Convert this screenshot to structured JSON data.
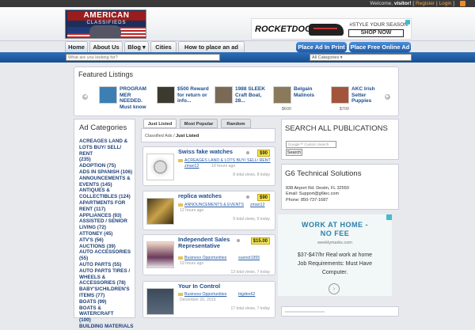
{
  "topbar": {
    "welcome_prefix": "Welcome, ",
    "user": "visitor!",
    "bracket_open": " [ ",
    "register": "Register",
    "sep": " | ",
    "login": "Login",
    "bracket_close": " ]"
  },
  "logo": {
    "line1": "AMERICAN",
    "line2": "CLASSIFIEDS"
  },
  "ad_banner": {
    "brand": "ROCKETDOG",
    "reg": "®",
    "tagline": "#STYLE YOUR SEASON",
    "box_text": "SHOP NOW"
  },
  "nav": {
    "items": [
      "Home",
      "About Us",
      "Blog ▾",
      "Cities",
      "How to place an ad"
    ]
  },
  "actions": {
    "print": "Place Ad In Print",
    "free": "Place Free Online Ad"
  },
  "search": {
    "placeholder": "What are you looking for?",
    "category": "All Categories"
  },
  "featured": {
    "title": "Featured Listings",
    "items": [
      {
        "title": "PROGRAM MER NEEDED. Must know",
        "price": ""
      },
      {
        "title": "$500 Reward for return or info...",
        "price": ""
      },
      {
        "title": "1988 SLEEK Craft Boat, 28...",
        "price": ""
      },
      {
        "title": "Belgain Malinois",
        "price": "$600"
      },
      {
        "title": "AKC Irish Setter Puppies",
        "price": "$700"
      }
    ]
  },
  "categories": {
    "title": "Ad Categories",
    "items": [
      "ACREAGES LAND &",
      "LOTS BUY/ SELL/ RENT",
      "(235)",
      "ADOPTION (75)",
      "ADS IN SPANISH (106)",
      "ANNOUNCEMENTS &",
      "EVENTS (145)",
      "ANTIQUES &",
      "COLLECTIBLES (124)",
      "APARTMENTS FOR",
      "RENT (117)",
      "APPLIANCES (93)",
      "ASSISTED / SENIOR",
      "LIVING (72)",
      "ATTONEY (45)",
      "ATV'S (56)",
      "AUCTIONS (39)",
      "AUTO ACCESSORIES",
      "(55)",
      "AUTO PARTS (55)",
      "AUTO PARTS TIRES /",
      "WHEELS &",
      "ACCESSORIES (78)",
      "BABY'S/CHILDREN'S",
      "ITEMS (77)",
      "BOATS (99)",
      "BOATS & WATERCRAFT",
      "(100)",
      "BUILDING MATERIALS"
    ]
  },
  "tabs": {
    "just_listed": "Just Listed",
    "most_popular": "Most Popular",
    "random": "Random"
  },
  "breadcrumb": {
    "root": "Classified Ads",
    "sep": " / ",
    "current": "Just Listed"
  },
  "listings": [
    {
      "title": "Swiss fake watches",
      "price": "$90",
      "category": "ACREAGES LAND & LOTS BUY/ SELL/ RENT",
      "user": "zman12",
      "time": "10 hours ago",
      "stats": "8 total views, 8 today"
    },
    {
      "title": "replica watches",
      "price": "$90",
      "category": "ANNOUNCEMENTS & EVENTS",
      "user": "zman12",
      "time": "12 hours ago",
      "stats": "9 total views, 9 today"
    },
    {
      "title": "Independent Sales Representative",
      "price": "$15.00",
      "category": "Business Opportunities",
      "user": "suenot1955",
      "time": "19 hours ago",
      "stats": "13 total views, 7 today"
    },
    {
      "title": "Your In Control",
      "price": "",
      "category": "Business Opportunities",
      "user": "bigdee62",
      "time": "December 20, 2015",
      "stats": "17 total views, 7 today"
    }
  ],
  "search_publications": {
    "title": "SEARCH ALL PUBLICATIONS",
    "placeholder": "Google™ Custom Search",
    "button": "Search"
  },
  "company": {
    "title": "G6 Technical Solutions",
    "address": "838 Airport Rd. Destin, FL 32550",
    "email": "Email: Support@g6tec.com",
    "phone": "Phone: 850-737-1687"
  },
  "google_ad": {
    "headline1": "WORK AT HOME -",
    "headline2": "NO FEE",
    "url": "weeklymarks.com",
    "desc1": "$37-$47/hr Real work at home",
    "desc2": "Job Requirements: Must Have",
    "desc3": "Computer."
  },
  "colors": {
    "nav_blue": "#1f5aa8",
    "link": "#1d4c8d",
    "price_tag": "#f4e649",
    "topbar": "#3a3a3a"
  }
}
